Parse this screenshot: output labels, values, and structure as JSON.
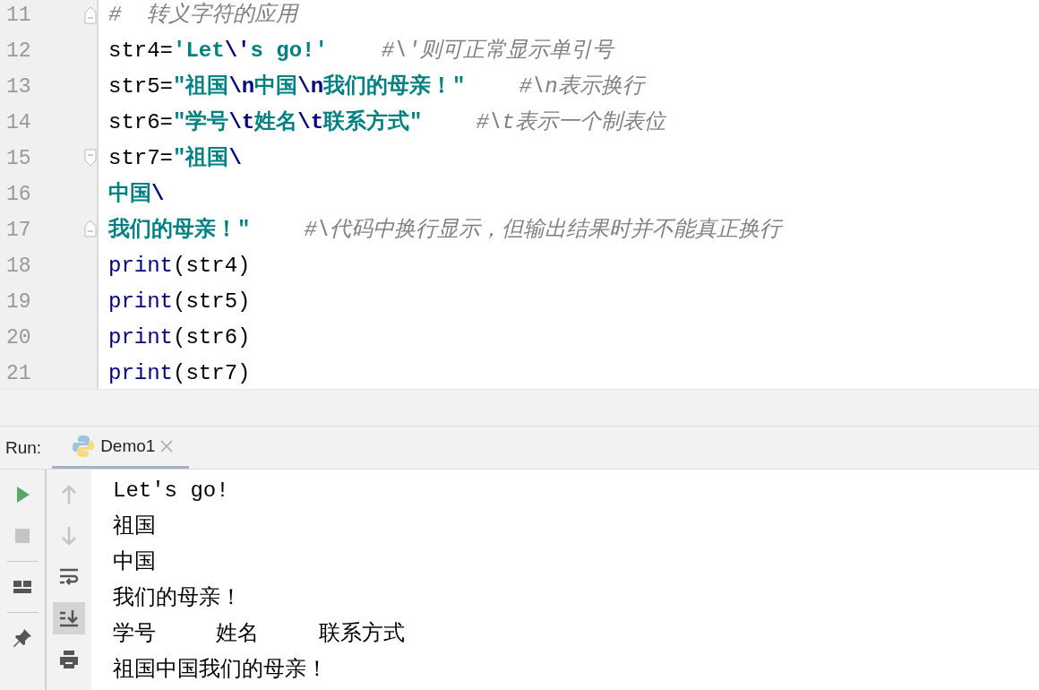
{
  "editor": {
    "lines": [
      {
        "number": "11",
        "fold_start": false,
        "fold_end": true,
        "tokens": [
          {
            "kind": "comment",
            "text": "#  转义字符的应用"
          }
        ]
      },
      {
        "number": "12",
        "fold_start": false,
        "fold_end": false,
        "tokens": [
          {
            "kind": "plain",
            "text": "str4="
          },
          {
            "kind": "string",
            "text": "'Let"
          },
          {
            "kind": "escape",
            "text": "\\'"
          },
          {
            "kind": "string",
            "text": "s go!'"
          },
          {
            "kind": "comment",
            "text": "#\\'则可正常显示单引号"
          }
        ]
      },
      {
        "number": "13",
        "fold_start": false,
        "fold_end": false,
        "tokens": [
          {
            "kind": "plain",
            "text": "str5="
          },
          {
            "kind": "string",
            "text": "\"祖国"
          },
          {
            "kind": "escape",
            "text": "\\n"
          },
          {
            "kind": "string",
            "text": "中国"
          },
          {
            "kind": "escape",
            "text": "\\n"
          },
          {
            "kind": "string",
            "text": "我们的母亲！\""
          },
          {
            "kind": "comment",
            "text": "#\\n表示换行"
          }
        ]
      },
      {
        "number": "14",
        "fold_start": false,
        "fold_end": false,
        "tokens": [
          {
            "kind": "plain",
            "text": "str6="
          },
          {
            "kind": "string",
            "text": "\"学号"
          },
          {
            "kind": "escape",
            "text": "\\t"
          },
          {
            "kind": "string",
            "text": "姓名"
          },
          {
            "kind": "escape",
            "text": "\\t"
          },
          {
            "kind": "string",
            "text": "联系方式\""
          },
          {
            "kind": "comment",
            "text": "#\\t表示一个制表位"
          }
        ]
      },
      {
        "number": "15",
        "fold_start": true,
        "fold_end": false,
        "tokens": [
          {
            "kind": "plain",
            "text": "str7="
          },
          {
            "kind": "string",
            "text": "\"祖国"
          },
          {
            "kind": "escape",
            "text": "\\"
          }
        ]
      },
      {
        "number": "16",
        "fold_start": false,
        "fold_end": false,
        "tokens": [
          {
            "kind": "string",
            "text": "中国"
          },
          {
            "kind": "escape",
            "text": "\\"
          }
        ]
      },
      {
        "number": "17",
        "fold_start": false,
        "fold_end": true,
        "tokens": [
          {
            "kind": "string",
            "text": "我们的母亲！\""
          },
          {
            "kind": "comment",
            "text": "#\\代码中换行显示，但输出结果时并不能真正换行"
          }
        ]
      },
      {
        "number": "18",
        "fold_start": false,
        "fold_end": false,
        "tokens": [
          {
            "kind": "builtin",
            "text": "print"
          },
          {
            "kind": "plain",
            "text": "(str4)"
          }
        ]
      },
      {
        "number": "19",
        "fold_start": false,
        "fold_end": false,
        "tokens": [
          {
            "kind": "builtin",
            "text": "print"
          },
          {
            "kind": "plain",
            "text": "(str5)"
          }
        ]
      },
      {
        "number": "20",
        "fold_start": false,
        "fold_end": false,
        "tokens": [
          {
            "kind": "builtin",
            "text": "print"
          },
          {
            "kind": "plain",
            "text": "(str6)"
          }
        ]
      },
      {
        "number": "21",
        "fold_start": false,
        "fold_end": false,
        "tokens": [
          {
            "kind": "builtin",
            "text": "print"
          },
          {
            "kind": "plain",
            "text": "(str7)"
          }
        ]
      }
    ]
  },
  "run_panel": {
    "label": "Run:",
    "tabs": [
      {
        "label": "Demo1",
        "selected": true
      }
    ],
    "left_tools": [
      {
        "kind": "run",
        "disabled": false
      },
      {
        "kind": "stop",
        "disabled": true
      },
      {
        "kind": "divider"
      },
      {
        "kind": "layout",
        "disabled": false
      },
      {
        "kind": "divider"
      },
      {
        "kind": "pin",
        "disabled": false
      }
    ],
    "right_tools": [
      {
        "kind": "up",
        "disabled": true,
        "on": false
      },
      {
        "kind": "down",
        "disabled": true,
        "on": false
      },
      {
        "kind": "wrap",
        "disabled": false,
        "on": false
      },
      {
        "kind": "scroll-end",
        "disabled": false,
        "on": true
      },
      {
        "kind": "print",
        "disabled": false,
        "on": false
      }
    ],
    "output": [
      "Let's go!",
      "祖国",
      "中国",
      "我们的母亲！",
      "学号\t姓名\t联系方式",
      "祖国中国我们的母亲！"
    ]
  }
}
